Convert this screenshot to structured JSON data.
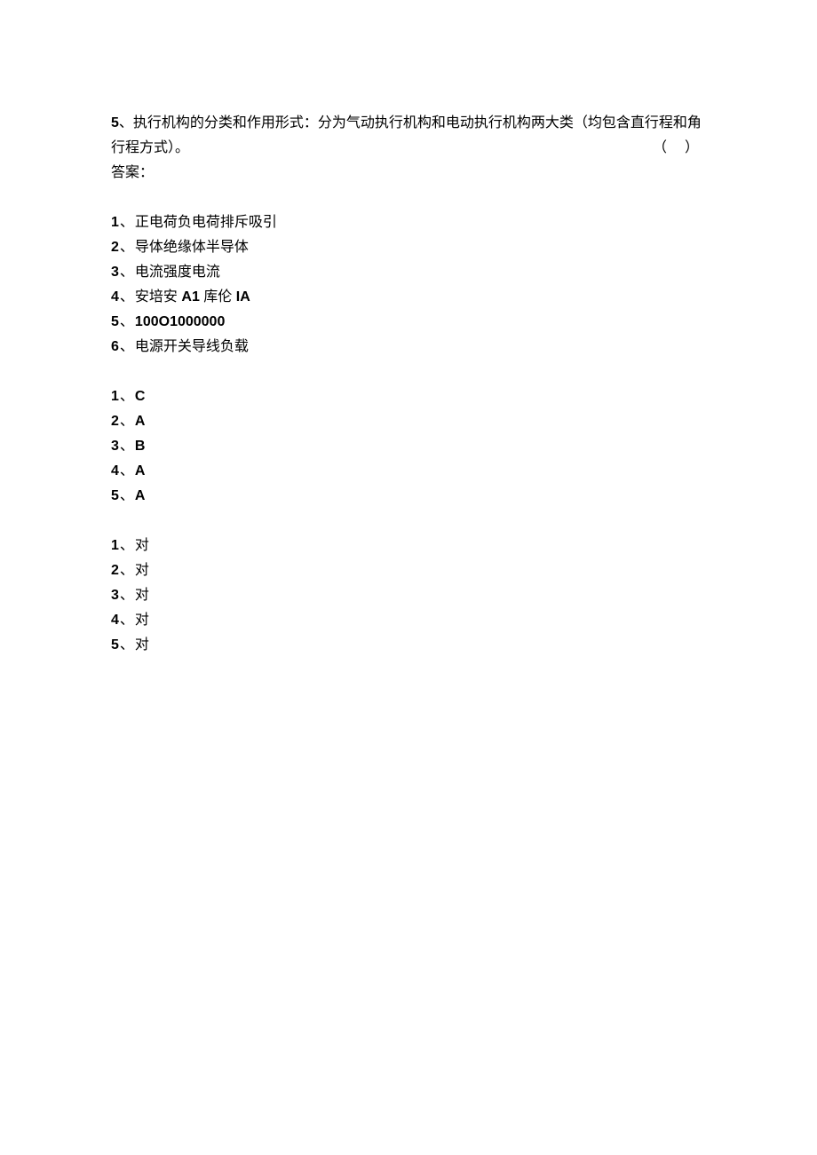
{
  "question5": {
    "num": "5",
    "sep": "、",
    "text_line1_prefix": "执行机构的分类和作用形式：分为气动执行机构和电动执行机构两大类（均包含直行程和角",
    "text_line2": "行程方式）。",
    "bracket": "（   ）"
  },
  "answer_label": "答案：",
  "fill_blank": [
    {
      "num": "1",
      "sep": "、",
      "text": "正电荷负电荷排斥吸引"
    },
    {
      "num": "2",
      "sep": "、",
      "text": "导体绝缘体半导体"
    },
    {
      "num": "3",
      "sep": "、",
      "text": "电流强度电流"
    },
    {
      "num": "4",
      "sep": "、",
      "prefix": "安培安",
      "mid1": " A1 ",
      "mid_cn": "库伦",
      "mid2": " IA"
    },
    {
      "num": "5",
      "sep": "、",
      "bold": "100O1000000"
    },
    {
      "num": "6",
      "sep": "、",
      "text": "电源开关导线负载"
    }
  ],
  "choice": [
    {
      "num": "1",
      "sep": "、",
      "ans": "C"
    },
    {
      "num": "2",
      "sep": "、",
      "ans": "A"
    },
    {
      "num": "3",
      "sep": "、",
      "ans": "B"
    },
    {
      "num": "4",
      "sep": "、",
      "ans": "A"
    },
    {
      "num": "5",
      "sep": "、",
      "ans": "A"
    }
  ],
  "judge": [
    {
      "num": "1",
      "sep": "、",
      "ans": "对"
    },
    {
      "num": "2",
      "sep": "、",
      "ans": "对"
    },
    {
      "num": "3",
      "sep": "、",
      "ans": "对"
    },
    {
      "num": "4",
      "sep": "、",
      "ans": "对"
    },
    {
      "num": "5",
      "sep": "、",
      "ans": "对"
    }
  ]
}
